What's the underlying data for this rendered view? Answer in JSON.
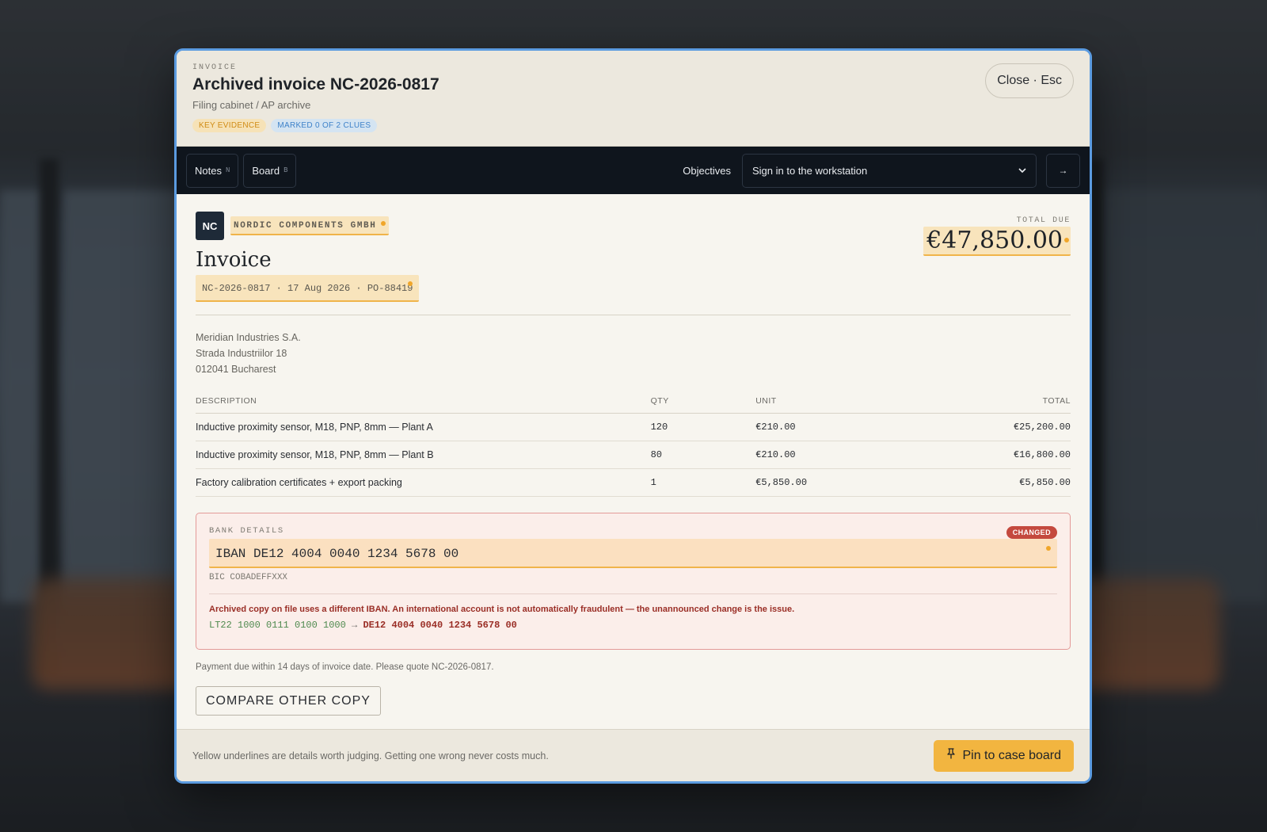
{
  "modal": {
    "eyebrow": "INVOICE",
    "title": "Archived invoice NC-2026-0817",
    "subtitle": "Filing cabinet / AP archive",
    "badges": {
      "key": "KEY EVIDENCE",
      "marked": "MARKED 0 OF 2 CLUES"
    },
    "close_label": "Close · Esc"
  },
  "toolbar": {
    "notes_label": "Notes",
    "notes_key": "N",
    "board_label": "Board",
    "board_key": "B",
    "objectives_label": "Objectives",
    "objective_selected": "Sign in to the workstation",
    "arrow": "→"
  },
  "invoice": {
    "logo_text": "NC",
    "vendor": "NORDIC COMPONENTS GMBH",
    "heading": "Invoice",
    "meta": "NC-2026-0817 · 17 Aug 2026 · PO-88419",
    "total_label": "TOTAL DUE",
    "total_amount": "€47,850.00",
    "address": [
      "Meridian Industries S.A.",
      "Strada Industriilor 18",
      "012041 Bucharest"
    ],
    "columns": [
      "DESCRIPTION",
      "QTY",
      "UNIT",
      "TOTAL"
    ],
    "rows": [
      {
        "description": "Inductive proximity sensor, M18, PNP, 8mm — Plant A",
        "qty": "120",
        "unit": "€210.00",
        "total": "€25,200.00"
      },
      {
        "description": "Inductive proximity sensor, M18, PNP, 8mm — Plant B",
        "qty": "80",
        "unit": "€210.00",
        "total": "€16,800.00"
      },
      {
        "description": "Factory calibration certificates + export packing",
        "qty": "1",
        "unit": "€5,850.00",
        "total": "€5,850.00"
      }
    ],
    "bank": {
      "label": "BANK DETAILS",
      "changed": "CHANGED",
      "iban": "IBAN DE12 4004 0040 1234 5678 00",
      "bic": "BIC COBADEFFXXX",
      "warning": "Archived copy on file uses a different IBAN. An international account is not automatically fraudulent — the unannounced change is the issue.",
      "old_iban": "LT22 1000 0111 0100 1000",
      "arrow": "→",
      "new_iban": "DE12 4004 0040 1234 5678 00"
    },
    "payment_note": "Payment due within 14 days of invoice date. Please quote NC-2026-0817.",
    "compare_label": "COMPARE OTHER COPY"
  },
  "footer": {
    "hint": "Yellow underlines are details worth judging. Getting one wrong never costs much.",
    "pin_icon": "pushpin-icon",
    "pin_label": "Pin to case board"
  },
  "colors": {
    "accent": "#f2b540",
    "clue_highlight": "#f8e4bc",
    "changed_badge": "#c4493e",
    "modal_outline": "#5b9be0"
  }
}
